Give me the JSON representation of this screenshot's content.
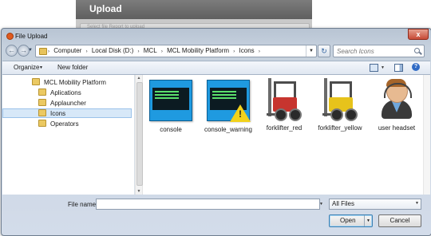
{
  "background_page": {
    "title": "Upload",
    "field_text": "Select file Report to upload"
  },
  "window": {
    "title": "File Upload",
    "close_glyph": "x"
  },
  "address_bar": {
    "back_glyph": "←",
    "forward_glyph": "→",
    "breadcrumbs": [
      "Computer",
      "Local Disk (D:)",
      "MCL",
      "MCL Mobility Platform",
      "Icons"
    ],
    "separator": "›",
    "refresh_glyph": "↻"
  },
  "search": {
    "placeholder": "Search Icons"
  },
  "toolbar": {
    "organize_label": "Organize",
    "new_folder_label": "New folder",
    "help_glyph": "?"
  },
  "navigation_tree": [
    {
      "label": "MCL Mobility Platform",
      "level": 0,
      "selected": false
    },
    {
      "label": "Aplications",
      "level": 1,
      "selected": false
    },
    {
      "label": "Applauncher",
      "level": 1,
      "selected": false
    },
    {
      "label": "Icons",
      "level": 1,
      "selected": true
    },
    {
      "label": "Operators",
      "level": 1,
      "selected": false
    }
  ],
  "files": [
    {
      "label": "console",
      "icon": "console-icon"
    },
    {
      "label": "console_warning",
      "icon": "console-warning-icon"
    },
    {
      "label": "forklifter_red",
      "icon": "forklift-red-icon",
      "color": "#c7352f"
    },
    {
      "label": "forklifter_yellow",
      "icon": "forklift-yellow-icon",
      "color": "#e7c31b"
    },
    {
      "label": "user headset",
      "icon": "user-headset-icon"
    }
  ],
  "form": {
    "file_name_label": "File name:",
    "file_name_value": "",
    "file_type_value": "All Files",
    "open_label": "Open",
    "cancel_label": "Cancel"
  }
}
